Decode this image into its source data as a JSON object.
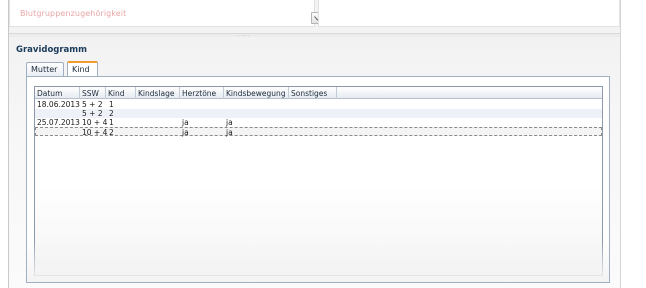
{
  "top_panel": {
    "faded_label": "Blutgruppenzugehörigkeit",
    "faded_sublabel": "",
    "splitter_dots": "·····"
  },
  "section": {
    "title": "Gravidogramm"
  },
  "tabs": [
    {
      "label": "Mutter",
      "active": false
    },
    {
      "label": "Kind",
      "active": true
    }
  ],
  "grid": {
    "columns": [
      "Datum",
      "SSW",
      "Kind",
      "Kindslage",
      "Herztöne",
      "Kindsbewegung",
      "Sonstiges"
    ],
    "rows": [
      {
        "datum": "18.06.2013",
        "ssw": "5 + 2",
        "kind": "1",
        "kindslage": "",
        "herztoene": "",
        "kindsbewegung": "",
        "sonstiges": ""
      },
      {
        "datum": "",
        "ssw": "5 + 2",
        "kind": "2",
        "kindslage": "",
        "herztoene": "",
        "kindsbewegung": "",
        "sonstiges": ""
      },
      {
        "datum": "25.07.2013",
        "ssw": "10 + 4",
        "kind": "1",
        "kindslage": "",
        "herztoene": "ja",
        "kindsbewegung": "ja",
        "sonstiges": ""
      },
      {
        "datum": "",
        "ssw": "10 + 4",
        "kind": "2",
        "kindslage": "",
        "herztoene": "ja",
        "kindsbewegung": "ja",
        "sonstiges": ""
      }
    ],
    "selected_row": 3
  },
  "colors": {
    "tab_accent": "#f39b2a",
    "section_title": "#1b3b5a",
    "faded_text": "#e8a6a6",
    "alt_row": "#eef2f8"
  }
}
